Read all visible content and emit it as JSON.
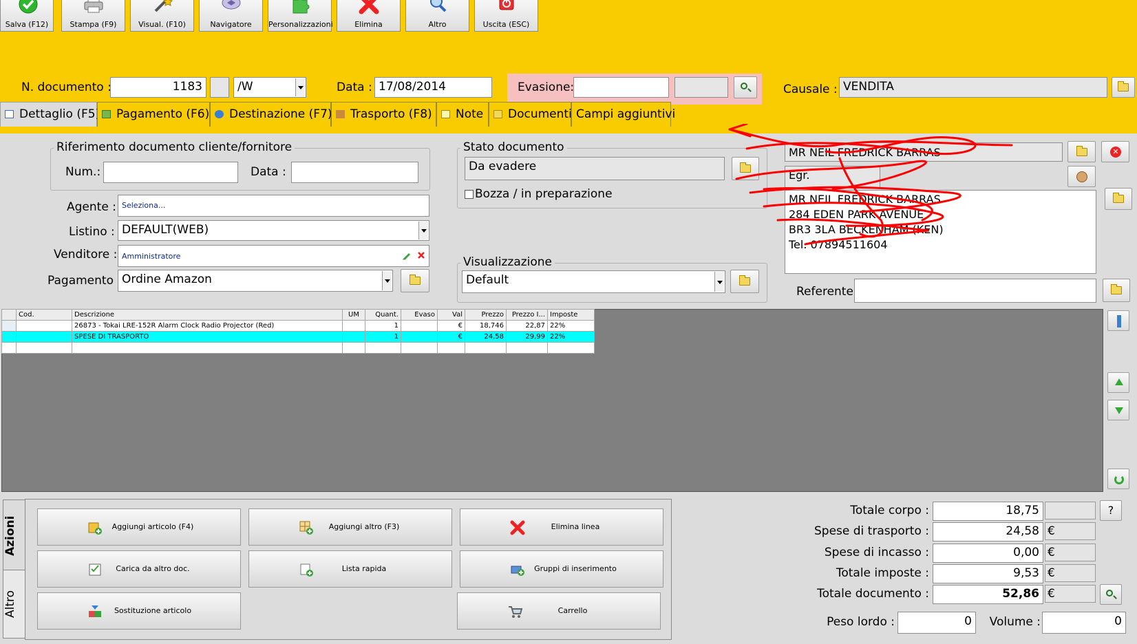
{
  "toolbar": {
    "buttons": [
      {
        "label": "Salva (F12)",
        "icon": "check-icon"
      },
      {
        "label": "Stampa (F9)",
        "icon": "printer-icon"
      },
      {
        "label": "Visual. (F10)",
        "icon": "magic-wand-icon"
      },
      {
        "label": "Navigatore",
        "icon": "compass-icon"
      },
      {
        "label": "Personalizzazioni",
        "icon": "puzzle-icon"
      },
      {
        "label": "Elimina",
        "icon": "red-x-icon"
      },
      {
        "label": "Altro",
        "icon": "magnifier-icon"
      },
      {
        "label": "Uscita (ESC)",
        "icon": "power-icon"
      }
    ]
  },
  "header": {
    "doc_number_label": "N. documento :",
    "doc_number": "1183",
    "doc_suffix": "/W",
    "date_label": "Data :",
    "date": "17/08/2014",
    "evasione_label": "Evasione:",
    "evasione_value": "",
    "causale_label": "Causale :",
    "causale_value": "VENDITA"
  },
  "tabs": [
    {
      "label": "Dettaglio (F5)",
      "active": true
    },
    {
      "label": "Pagamento (F6)"
    },
    {
      "label": "Destinazione (F7)"
    },
    {
      "label": "Trasporto (F8)"
    },
    {
      "label": "Note"
    },
    {
      "label": "Documenti"
    },
    {
      "label": "Campi aggiuntivi"
    }
  ],
  "riferimento": {
    "title": "Riferimento documento cliente/fornitore",
    "num_label": "Num.:",
    "num_value": "",
    "data_label": "Data :",
    "data_value": ""
  },
  "form": {
    "agente_label": "Agente :",
    "agente_value": "Seleziona...",
    "listino_label": "Listino :",
    "listino_value": "DEFAULT(WEB)",
    "venditore_label": "Venditore :",
    "venditore_value": "Amministratore",
    "pagamento_label": "Pagamento :",
    "pagamento_value": "Ordine Amazon"
  },
  "stato": {
    "title": "Stato documento",
    "value": "Da evadere",
    "bozza_label": "Bozza / in preparazione",
    "bozza_checked": false
  },
  "visualizzazione": {
    "title": "Visualizzazione",
    "value": "Default"
  },
  "customer": {
    "name": "MR NEIL FREDRICK BARRAS",
    "salutation": "Egr.",
    "address_lines": [
      "MR NEIL FREDRICK BARRAS",
      "284 EDEN PARK AVENUE",
      "BR3 3LA BECKENHAM (KEN)",
      "Tel. 07894511604"
    ],
    "referente_label": "Referente",
    "referente_value": ""
  },
  "grid": {
    "columns": [
      "Cod.",
      "Descrizione",
      "UM",
      "Quant.",
      "Evaso",
      "Val",
      "Prezzo",
      "Prezzo I...",
      "Imposte"
    ],
    "rows": [
      {
        "cod": "",
        "descrizione": "26873 - Tokai LRE-152R Alarm Clock Radio Projector (Red)",
        "um": "",
        "quant": "1",
        "evaso": "",
        "val": "€",
        "prezzo": "18,746",
        "prezzo_i": "22,87",
        "imposte": "22%",
        "selected": false
      },
      {
        "cod": "",
        "descrizione": "SPESE DI TRASPORTO",
        "um": "",
        "quant": "1",
        "evaso": "",
        "val": "€",
        "prezzo": "24,58",
        "prezzo_i": "29,99",
        "imposte": "22%",
        "selected": true
      },
      {
        "cod": "",
        "descrizione": "",
        "um": "",
        "quant": "",
        "evaso": "",
        "val": "",
        "prezzo": "",
        "prezzo_i": "",
        "imposte": "",
        "selected": false
      }
    ]
  },
  "actions": {
    "tab_azioni": "Azioni",
    "tab_altro": "Altro",
    "buttons": [
      {
        "label": "Aggiungi articolo (F4)",
        "icon": "add-item-icon"
      },
      {
        "label": "Aggiungi altro (F3)",
        "icon": "add-grid-icon"
      },
      {
        "label": "Elimina linea",
        "icon": "delete-line-icon"
      },
      {
        "label": "Carica da altro doc.",
        "icon": "load-doc-icon"
      },
      {
        "label": "Lista rapida",
        "icon": "quick-list-icon"
      },
      {
        "label": "Gruppi di inserimento",
        "icon": "insert-group-icon"
      },
      {
        "label": "Sostituzione articolo",
        "icon": "replace-item-icon"
      },
      {
        "label": "Carrello",
        "icon": "cart-icon"
      }
    ]
  },
  "totals": {
    "corpo_label": "Totale corpo :",
    "corpo_value": "18,75",
    "trasporto_label": "Spese di trasporto :",
    "trasporto_value": "24,58",
    "incasso_label": "Spese di incasso :",
    "incasso_value": "0,00",
    "imposte_label": "Totale imposte :",
    "imposte_value": "9,53",
    "documento_label": "Totale documento :",
    "documento_value": "52,86",
    "currency": "€",
    "help_label": "?",
    "peso_label": "Peso lordo :",
    "peso_value": "0",
    "volume_label": "Volume :",
    "volume_value": "0"
  },
  "colors": {
    "toolbar_yellow": "#f8cc00",
    "selected_row": "#00ffff",
    "evasione_bg": "#f7c0c0",
    "scribble_red": "#ff0000"
  }
}
